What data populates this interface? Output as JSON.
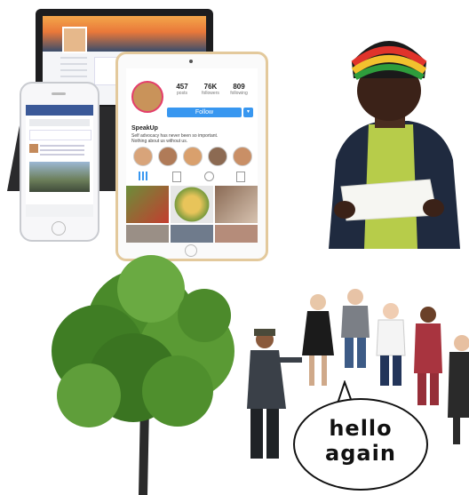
{
  "tablet_profile": {
    "posts_count": "457",
    "posts_label": "posts",
    "followers_count": "76K",
    "followers_label": "followers",
    "following_count": "809",
    "following_label": "following",
    "follow_button_label": "Follow",
    "follow_dropdown": "▾",
    "username": "SpeakUp",
    "bio": "Self advocacy has never been so important. Nothing about us without us."
  },
  "speech_bubble": {
    "line1": "hello",
    "line2": "again"
  }
}
